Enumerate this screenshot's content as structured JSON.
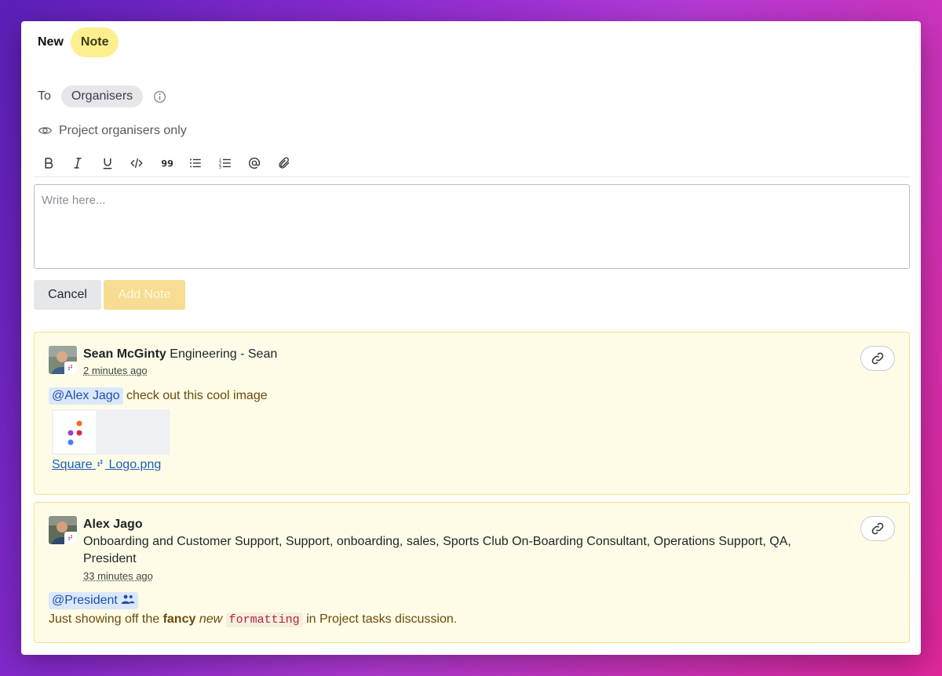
{
  "header": {
    "title_prefix": "New",
    "title_badge": "Note"
  },
  "recipient": {
    "to_label": "To",
    "chip_label": "Organisers",
    "info_icon": "info-icon"
  },
  "visibility": {
    "icon": "eye-icon",
    "label": "Project organisers only"
  },
  "toolbar": {
    "buttons": [
      "bold-icon",
      "italic-icon",
      "underline-icon",
      "code-icon",
      "quote-icon",
      "bullet-list-icon",
      "numbered-list-icon",
      "mention-icon",
      "attach-icon"
    ]
  },
  "editor": {
    "placeholder": "Write here..."
  },
  "actions": {
    "cancel_label": "Cancel",
    "add_label": "Add Note"
  },
  "notes": [
    {
      "author": "Sean McGinty",
      "role": "Engineering - Sean",
      "time": "2 minutes ago",
      "mention": "@Alex Jago",
      "text": "check out this cool image",
      "attachment": {
        "name_a": "Square",
        "name_b": "Logo.png"
      }
    },
    {
      "author": "Alex Jago",
      "role_line1": "Onboarding and Customer Support, Support, onboarding, sales, Sports Club On-Boarding Consultant, Operations Support, QA,",
      "role_line2": "President",
      "time": "33 minutes ago",
      "mention": "@President",
      "text_pre": "Just showing off the",
      "text_bold": "fancy",
      "text_italic": "new",
      "text_code": "formatting",
      "text_post": "in Project tasks discussion."
    }
  ],
  "colors": {
    "accent_yellow": "#fdef8d",
    "note_bg": "#fefce6",
    "mention_bg": "#dbe8fb",
    "link": "#1b5fc1"
  }
}
